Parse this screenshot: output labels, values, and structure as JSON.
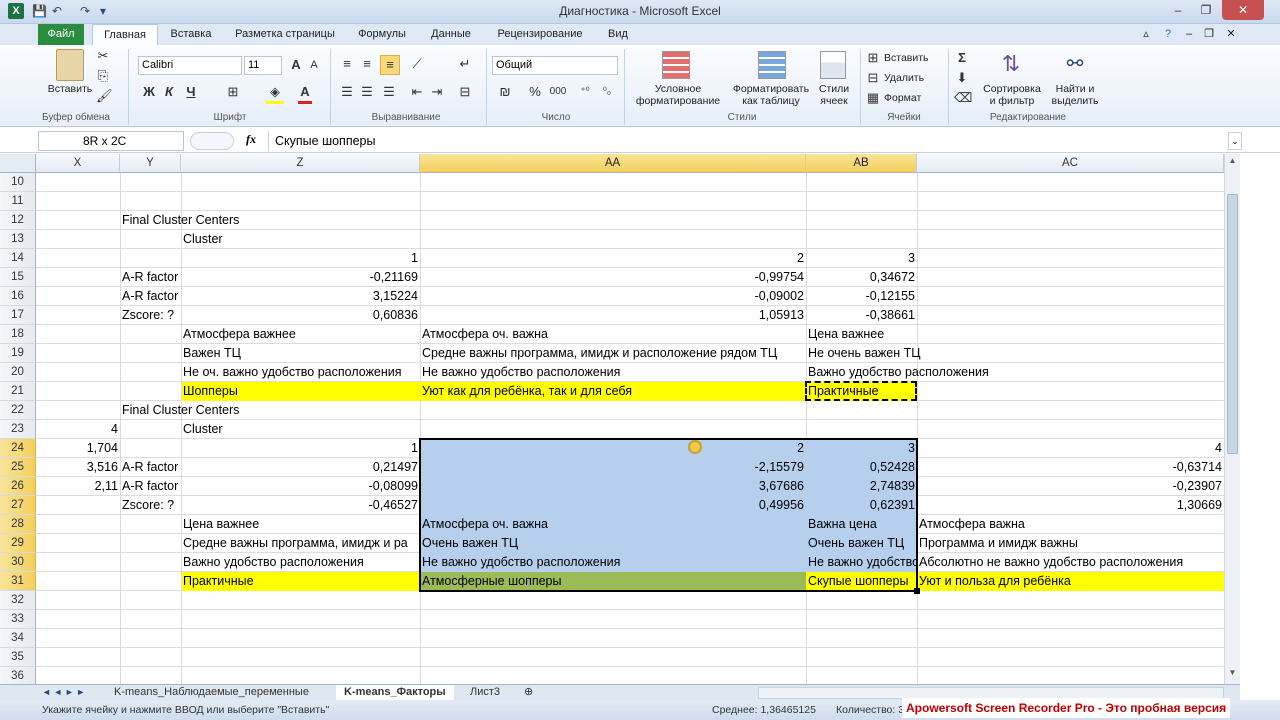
{
  "window": {
    "title": "Диагностика - Microsoft Excel",
    "app_icon": "X",
    "minimize": "–",
    "restore": "❐",
    "close": "✕"
  },
  "ribbon_tabs": {
    "file": "Файл",
    "items": [
      "Главная",
      "Вставка",
      "Разметка страницы",
      "Формулы",
      "Данные",
      "Рецензирование",
      "Вид"
    ],
    "active": "Главная"
  },
  "ribbon": {
    "clipboard": {
      "paste": "Вставить",
      "label": "Буфер обмена"
    },
    "font": {
      "family": "Calibri",
      "size": "11",
      "bold": "Ж",
      "italic": "К",
      "underline": "Ч",
      "label": "Шрифт"
    },
    "alignment": {
      "label": "Выравнивание"
    },
    "number": {
      "format": "Общий",
      "percent": "%",
      "thousands": "000",
      "label": "Число"
    },
    "styles": {
      "conditional": "Условное форматирование",
      "as_table": "Форматировать как таблицу",
      "cell_styles": "Стили ячеек",
      "label": "Стили"
    },
    "cells": {
      "insert": "Вставить",
      "delete": "Удалить",
      "format": "Формат",
      "label": "Ячейки"
    },
    "editing": {
      "sigma": "Σ",
      "sort": "Сортировка и фильтр",
      "find": "Найти и выделить",
      "label": "Редактирование"
    }
  },
  "formula_bar": {
    "name_box": "8R x 2C",
    "fx": "fx",
    "content": "Скупые шопперы"
  },
  "columns": [
    "X",
    "Y",
    "Z",
    "AA",
    "AB",
    "AC"
  ],
  "selected_columns": [
    "AA",
    "AB"
  ],
  "rows": [
    "10",
    "11",
    "12",
    "13",
    "14",
    "15",
    "16",
    "17",
    "18",
    "19",
    "20",
    "21",
    "22",
    "23",
    "24",
    "25",
    "26",
    "27",
    "28",
    "29",
    "30",
    "31",
    "32",
    "33",
    "34",
    "35",
    "36"
  ],
  "selected_rows": [
    "24",
    "25",
    "26",
    "27",
    "28",
    "29",
    "30",
    "31"
  ],
  "cells": {
    "r12": {
      "y": "Final Cluster Centers"
    },
    "r13": {
      "z": "Cluster"
    },
    "r14": {
      "z": "1",
      "aa": "2",
      "ab": "3"
    },
    "r15": {
      "y": "A-R  factor",
      "z": "-0,21169",
      "aa": "-0,99754",
      "ab": "0,34672"
    },
    "r16": {
      "y": "A-R  factor",
      "z": "3,15224",
      "aa": "-0,09002",
      "ab": "-0,12155"
    },
    "r17": {
      "y": "Zscore:  ?",
      "z": "0,60836",
      "aa": "1,05913",
      "ab": "-0,38661"
    },
    "r18": {
      "z": "Атмосфера важнее",
      "aa": "Атмосфера оч. важна",
      "ab": "Цена важнее"
    },
    "r19": {
      "z": "Важен ТЦ",
      "aa": "Средне важны программа, имидж и расположение рядом ТЦ",
      "ab": "Не очень важен ТЦ"
    },
    "r20": {
      "z": "Не оч. важно удобство расположения",
      "aa": "Не важно удобство расположения",
      "ab": "Важно удобство расположения"
    },
    "r21": {
      "z": "Шопперы",
      "aa": "Уют как для ребёнка, так и для себя",
      "ab": "Практичные"
    },
    "r22": {
      "y": "Final Cluster Centers"
    },
    "r23": {
      "x": "4",
      "z": "Cluster"
    },
    "r24": {
      "x": "1,704",
      "z": "1",
      "aa": "2",
      "ab": "3",
      "ac": "4"
    },
    "r25": {
      "x": "3,516",
      "y": "A-R  factor",
      "z": "0,21497",
      "aa": "-2,15579",
      "ab": "0,52428",
      "ac": "-0,63714"
    },
    "r26": {
      "x": "2,11",
      "y": "A-R  factor",
      "z": "-0,08099",
      "aa": "3,67686",
      "ab": "2,74839",
      "ac": "-0,23907"
    },
    "r27": {
      "y": "Zscore:  ?",
      "z": "-0,46527",
      "aa": "0,49956",
      "ab": "0,62391",
      "ac": "1,30669"
    },
    "r28": {
      "z": "Цена важнее",
      "aa": "Атмосфера оч. важна",
      "ab": "Важна цена",
      "ac": "Атмосфера важна"
    },
    "r29": {
      "z": "Средне важны программа, имидж и ра",
      "aa": "Очень важен ТЦ",
      "ab": "Очень важен ТЦ",
      "ac": "Программа и имидж важны"
    },
    "r30": {
      "z": "Важно удобство расположения",
      "aa": "Не важно удобство расположения",
      "ab": "Не важно удобство",
      "ac": "Абсолютно не важно удобство расположения"
    },
    "r31": {
      "z": "Практичные",
      "aa": "Атмосферные шопперы",
      "ab": "Скупые шопперы",
      "ac": "Уют и польза для ребёнка"
    }
  },
  "sheet_tabs": {
    "nav": "◄ ◄ ► ►",
    "items": [
      "K-means_Наблюдаемые_переменные",
      "K-means_Факторы",
      "Лист3"
    ],
    "active": "K-means_Факторы"
  },
  "status_bar": {
    "message": "Укажите ячейку и нажмите ВВОД или выберите \"Вставить\"",
    "average": "Среднее: 1,36465125",
    "count": "Количество: 3",
    "watermark": "Apowersoft Screen Recorder Pro - Это пробная версия"
  },
  "colors": {
    "highlight_yellow": "#ffff00",
    "highlight_green": "#9bbb59",
    "selection_blue": "#b6cfed",
    "file_tab": "#2a8c3e"
  }
}
